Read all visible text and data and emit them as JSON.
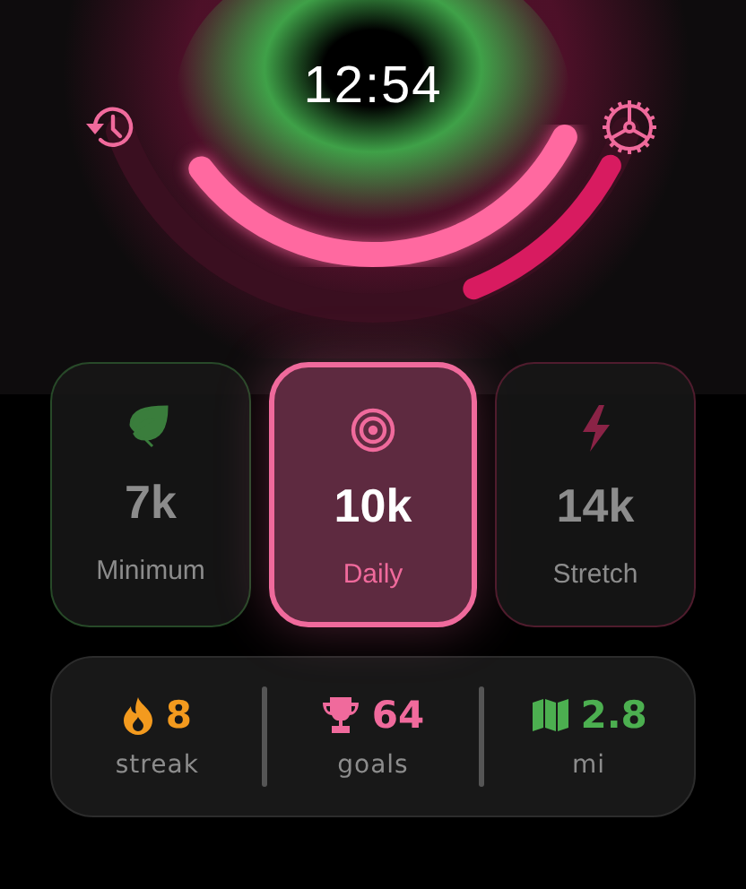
{
  "header": {
    "time": "12:54"
  },
  "goals": [
    {
      "kind": "leaf",
      "value": "7k",
      "label": "Minimum",
      "color": "#3a7d3c",
      "selected": false
    },
    {
      "kind": "target",
      "value": "10k",
      "label": "Daily",
      "color": "#f06a9c",
      "selected": true
    },
    {
      "kind": "bolt",
      "value": "14k",
      "label": "Stretch",
      "color": "#8a2346",
      "selected": false
    }
  ],
  "stats": [
    {
      "kind": "flame",
      "value": "8",
      "label": "streak",
      "color": "#f39a1e"
    },
    {
      "kind": "trophy",
      "value": "64",
      "label": "goals",
      "color": "#f06a9c"
    },
    {
      "kind": "map",
      "value": "2.8",
      "label": "mi",
      "color": "#4caf50"
    }
  ]
}
